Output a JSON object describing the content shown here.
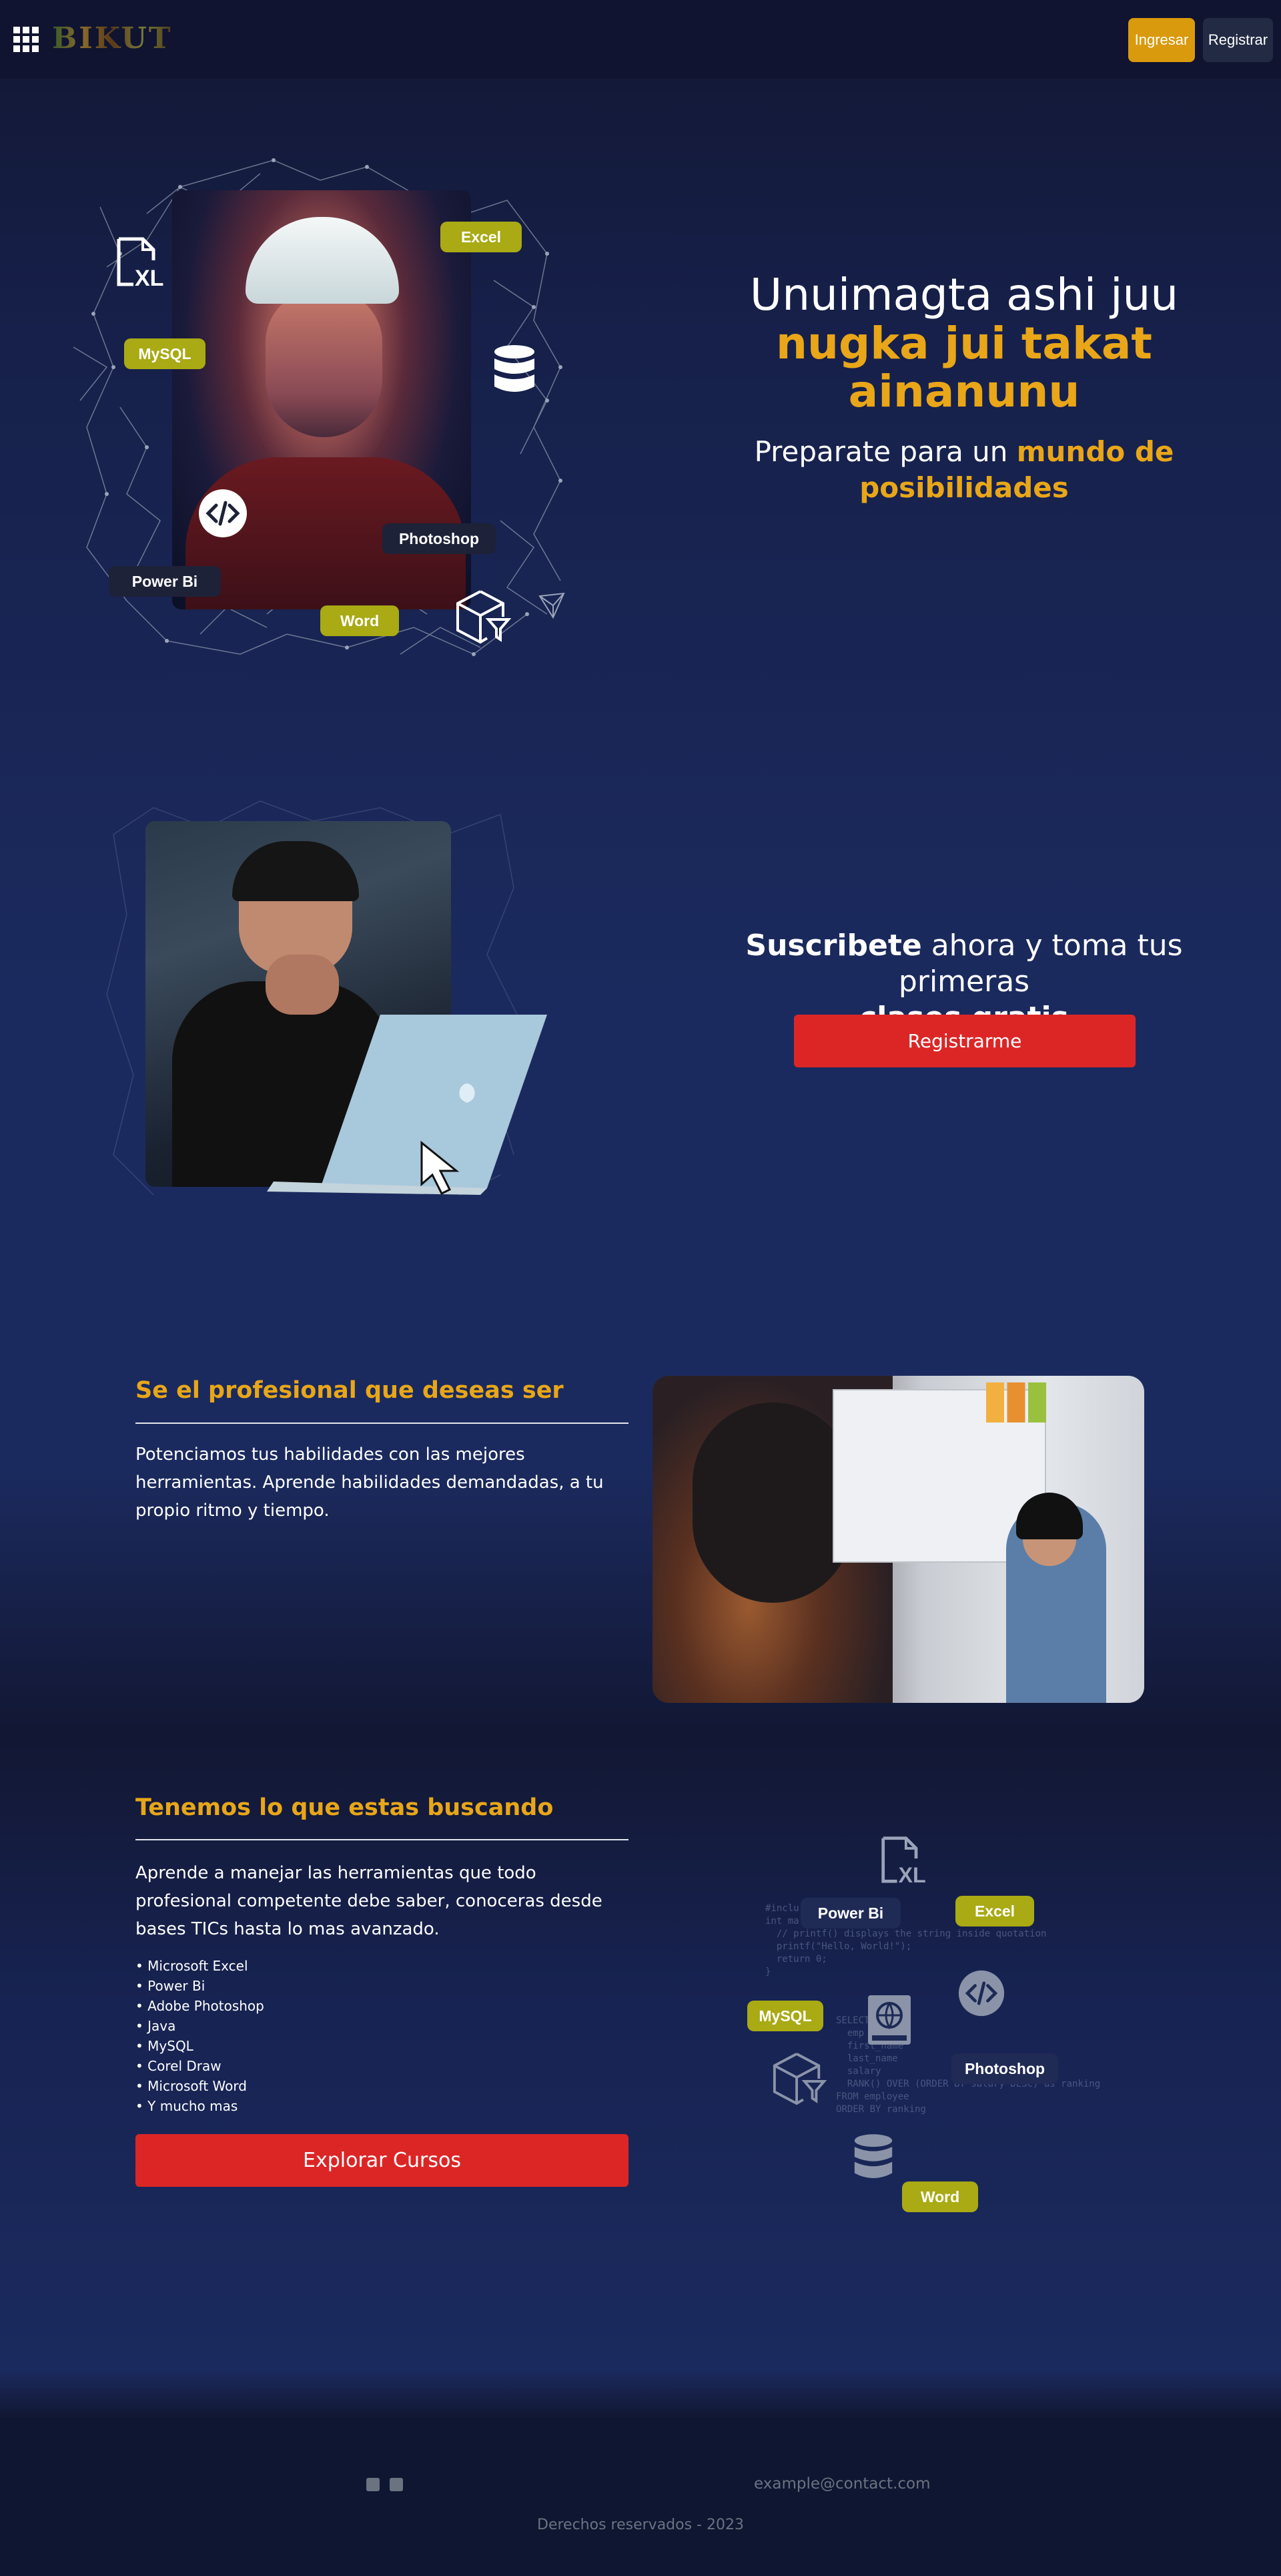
{
  "navbar": {
    "logo_text": "BIKUT",
    "login_label": "Ingresar",
    "register_label": "Registrar"
  },
  "hero": {
    "title_line1": "Unuimagta ashi juu",
    "title_line2": "nugka jui takat",
    "title_line3": "ainanunu",
    "subtitle_plain": "Preparate para un ",
    "subtitle_highlight": "mundo de posibilidades",
    "tags": {
      "excel": "Excel",
      "mysql": "MySQL",
      "photoshop": "Photoshop",
      "powerbi": "Power Bi",
      "word": "Word"
    }
  },
  "subscribe": {
    "bold1": "Suscribete",
    "plain": " ahora y toma tus primeras",
    "bold2": "clases gratis",
    "button_label": "Registrarme"
  },
  "profesional": {
    "title": "Se el profesional que deseas ser",
    "body": "Potenciamos tus habilidades con las mejores herramientas. Aprende habilidades demandadas, a tu propio ritmo y tiempo."
  },
  "cursos": {
    "title": "Tenemos lo que estas buscando",
    "body": "Aprende a manejar las herramientas que todo profesional competente debe saber, conoceras desde bases TICs hasta lo mas avanzado.",
    "items": [
      "• Microsoft Excel",
      "• Power Bi",
      "• Adobe Photoshop",
      "• Java",
      "• MySQL",
      "• Corel Draw",
      "• Microsoft Word",
      "• Y mucho mas"
    ],
    "button_label": "Explorar Cursos",
    "tags": {
      "powerbi": "Power Bi",
      "excel": "Excel",
      "mysql": "MySQL",
      "photoshop": "Photoshop",
      "word": "Word"
    }
  },
  "footer": {
    "email": "example@contact.com",
    "copyright": "Derechos reservados - 2023"
  },
  "colors": {
    "accent": "#e8a618",
    "button_red": "#dc2626",
    "tag_olive": "#a9aa14",
    "nav_bg": "#101430",
    "login_bg": "#d99a0d"
  },
  "icons": [
    "grid-menu-icon",
    "excel-file-icon",
    "database-icon",
    "code-icon",
    "box-filter-icon",
    "cursor-icon",
    "book-globe-icon",
    "facebook-icon",
    "twitter-icon"
  ]
}
